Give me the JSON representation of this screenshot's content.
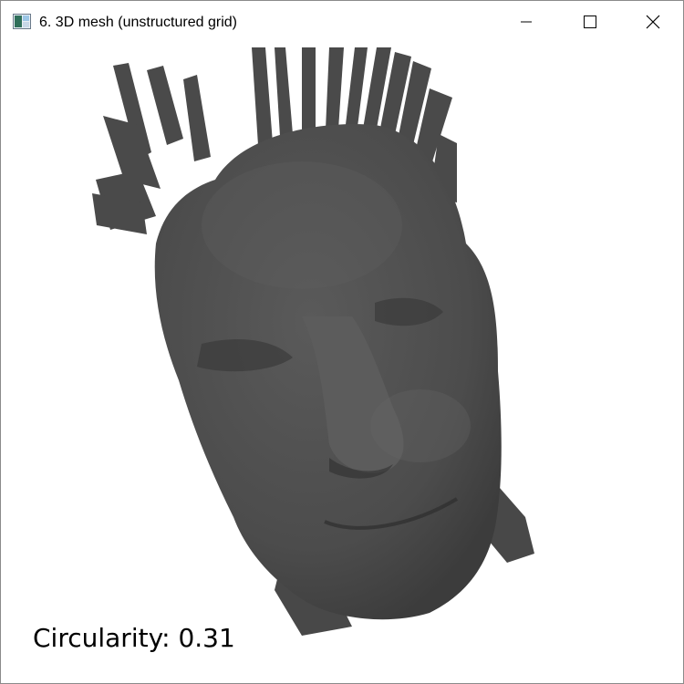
{
  "window": {
    "title": "6. 3D mesh (unstructured grid)",
    "app_icon": "vtk-app-icon",
    "controls": {
      "minimize_icon": "minimize-icon",
      "maximize_icon": "maximize-icon",
      "close_icon": "close-icon"
    }
  },
  "viewport": {
    "background": "#ffffff",
    "mesh_color": "#505050",
    "mesh_subject": "face-mesh",
    "overlay_text": "Circularity: 0.31"
  }
}
